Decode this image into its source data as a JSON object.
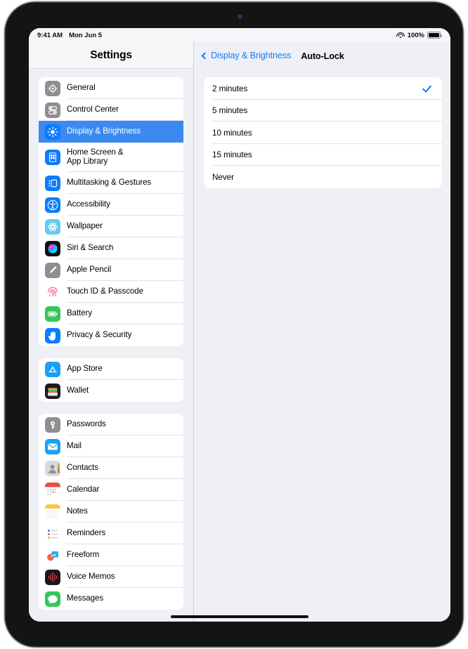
{
  "status_bar": {
    "time": "9:41 AM",
    "date": "Mon Jun 5",
    "wifi_icon": "wifi-icon",
    "battery_percent": "100%",
    "battery_icon": "battery-full-icon"
  },
  "sidebar": {
    "title": "Settings",
    "groups": [
      {
        "items": [
          {
            "label": "General",
            "icon": "gear-icon",
            "selected": false
          },
          {
            "label": "Control Center",
            "icon": "control-center-icon",
            "selected": false
          },
          {
            "label": "Display & Brightness",
            "icon": "brightness-sun-icon",
            "selected": true
          },
          {
            "label": "Home Screen &\nApp Library",
            "icon": "home-screen-icon",
            "selected": false,
            "tall": true
          },
          {
            "label": "Multitasking & Gestures",
            "icon": "multitasking-icon",
            "selected": false
          },
          {
            "label": "Accessibility",
            "icon": "accessibility-icon",
            "selected": false
          },
          {
            "label": "Wallpaper",
            "icon": "wallpaper-icon",
            "selected": false
          },
          {
            "label": "Siri & Search",
            "icon": "siri-icon",
            "selected": false
          },
          {
            "label": "Apple Pencil",
            "icon": "apple-pencil-icon",
            "selected": false
          },
          {
            "label": "Touch ID & Passcode",
            "icon": "touch-id-icon",
            "selected": false
          },
          {
            "label": "Battery",
            "icon": "battery-icon",
            "selected": false
          },
          {
            "label": "Privacy & Security",
            "icon": "privacy-hand-icon",
            "selected": false
          }
        ]
      },
      {
        "items": [
          {
            "label": "App Store",
            "icon": "app-store-icon",
            "selected": false
          },
          {
            "label": "Wallet",
            "icon": "wallet-icon",
            "selected": false
          }
        ]
      },
      {
        "items": [
          {
            "label": "Passwords",
            "icon": "passwords-key-icon",
            "selected": false
          },
          {
            "label": "Mail",
            "icon": "mail-icon",
            "selected": false
          },
          {
            "label": "Contacts",
            "icon": "contacts-icon",
            "selected": false
          },
          {
            "label": "Calendar",
            "icon": "calendar-icon",
            "selected": false
          },
          {
            "label": "Notes",
            "icon": "notes-icon",
            "selected": false
          },
          {
            "label": "Reminders",
            "icon": "reminders-icon",
            "selected": false
          },
          {
            "label": "Freeform",
            "icon": "freeform-icon",
            "selected": false
          },
          {
            "label": "Voice Memos",
            "icon": "voice-memos-icon",
            "selected": false
          },
          {
            "label": "Messages",
            "icon": "messages-icon",
            "selected": false
          }
        ]
      }
    ]
  },
  "detail": {
    "back_label": "Display & Brightness",
    "back_icon": "chevron-left-icon",
    "title": "Auto-Lock",
    "options": [
      {
        "label": "2 minutes",
        "checked": true
      },
      {
        "label": "5 minutes",
        "checked": false
      },
      {
        "label": "10 minutes",
        "checked": false
      },
      {
        "label": "15 minutes",
        "checked": false
      },
      {
        "label": "Never",
        "checked": false
      }
    ]
  },
  "colors": {
    "accent_blue": "#0a7cff",
    "selection_blue": "#3b8aef",
    "screen_background": "#eff0f5",
    "card_white": "#ffffff"
  }
}
